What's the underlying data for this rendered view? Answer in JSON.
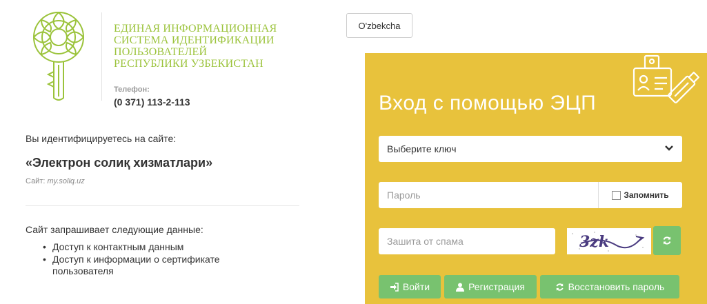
{
  "org": {
    "title_lines": [
      "ЕДИНАЯ ИНФОРМАЦИОННАЯ",
      "СИСТЕМА ИДЕНТИФИКАЦИИ",
      "ПОЛЬЗОВАТЕЛЕЙ",
      "РЕСПУБЛИКИ УЗБЕКИСТАН"
    ],
    "phone_label": "Телефон:",
    "phone": "(0 371) 113-2-113",
    "brand_color": "#9bc33b"
  },
  "identity": {
    "intro": "Вы идентифицируетесь на сайте:",
    "site_name": "«Электрон солиқ хизматлари»",
    "site_prefix": "Сайт:",
    "site_url": "my.soliq.uz"
  },
  "request": {
    "title": "Сайт запрашивает следующие данные:",
    "items": [
      "Доступ к контактным данным",
      "Доступ к информации о сертификате пользователя"
    ]
  },
  "language": {
    "label": "O'zbekcha"
  },
  "login": {
    "title": "Вход с помощью ЭЦП",
    "panel_color": "#e8c23c",
    "button_color": "#78c26f",
    "key_select": "Выберите ключ",
    "password_placeholder": "Пароль",
    "remember_label": "Запомнить",
    "spam_placeholder": "Зашита от спама",
    "captcha_text": "3zk",
    "buttons": {
      "login": "Войти",
      "register": "Регистрация",
      "restore": "Восстановить пароль"
    },
    "icons": [
      "sign-in-icon",
      "user-icon",
      "refresh-icon",
      "chevron-down-icon",
      "id-card-usb-icon"
    ]
  }
}
